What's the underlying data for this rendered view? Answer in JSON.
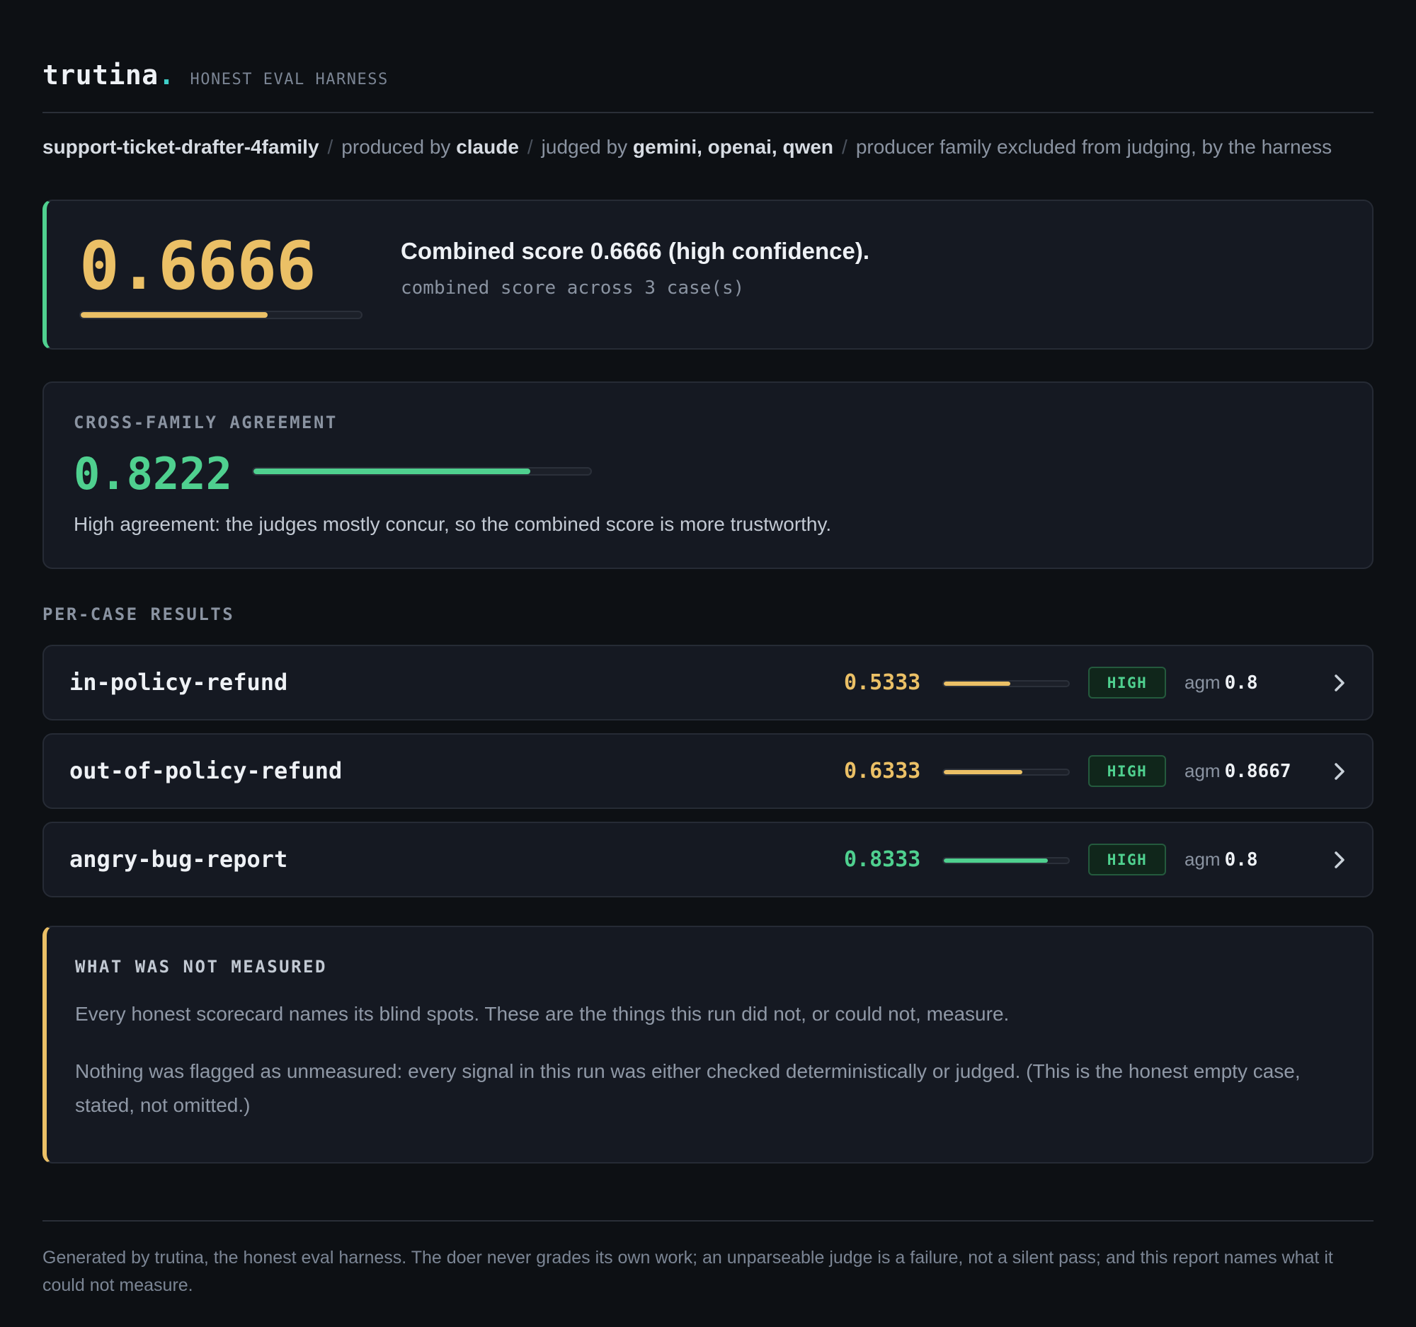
{
  "header": {
    "brand": "trutina",
    "brand_dot": ".",
    "tagline": "HONEST EVAL HARNESS"
  },
  "breadcrumb": {
    "suite": "support-ticket-drafter-4family",
    "produced_prefix": "produced by ",
    "producer": "claude",
    "judged_prefix": "judged by ",
    "judges": "gemini, openai, qwen",
    "note": "producer family excluded from judging, by the harness",
    "separator": "/"
  },
  "combined": {
    "score": "0.6666",
    "fraction": 0.6666,
    "title": "Combined score 0.6666 (high confidence).",
    "subtitle": "combined score across 3 case(s)",
    "color": "#ebc066"
  },
  "agreement": {
    "label": "CROSS-FAMILY AGREEMENT",
    "score": "0.8222",
    "fraction": 0.8222,
    "note": "High agreement: the judges mostly concur, so the combined score is more trustworthy.",
    "color": "#4fd08f"
  },
  "per_case": {
    "label": "PER-CASE RESULTS",
    "cases": [
      {
        "name": "in-policy-refund",
        "score": "0.5333",
        "fraction": 0.5333,
        "color": "#ebc066",
        "badge": "HIGH",
        "agm_label": "agm",
        "agm_value": "0.8"
      },
      {
        "name": "out-of-policy-refund",
        "score": "0.6333",
        "fraction": 0.6333,
        "color": "#ebc066",
        "badge": "HIGH",
        "agm_label": "agm",
        "agm_value": "0.8667"
      },
      {
        "name": "angry-bug-report",
        "score": "0.8333",
        "fraction": 0.8333,
        "color": "#4fd08f",
        "badge": "HIGH",
        "agm_label": "agm",
        "agm_value": "0.8"
      }
    ]
  },
  "not_measured": {
    "label": "WHAT WAS NOT MEASURED",
    "intro": "Every honest scorecard names its blind spots. These are the things this run did not, or could not, measure.",
    "body": "Nothing was flagged as unmeasured: every signal in this run was either checked deterministically or judged. (This is the honest empty case, stated, not omitted.)"
  },
  "footer": {
    "text": "Generated by trutina, the honest eval harness. The doer never grades its own work; an unparseable judge is a failure, not a silent pass; and this report names what it could not measure."
  },
  "icons": {
    "chevron": "chevron-right-icon"
  }
}
